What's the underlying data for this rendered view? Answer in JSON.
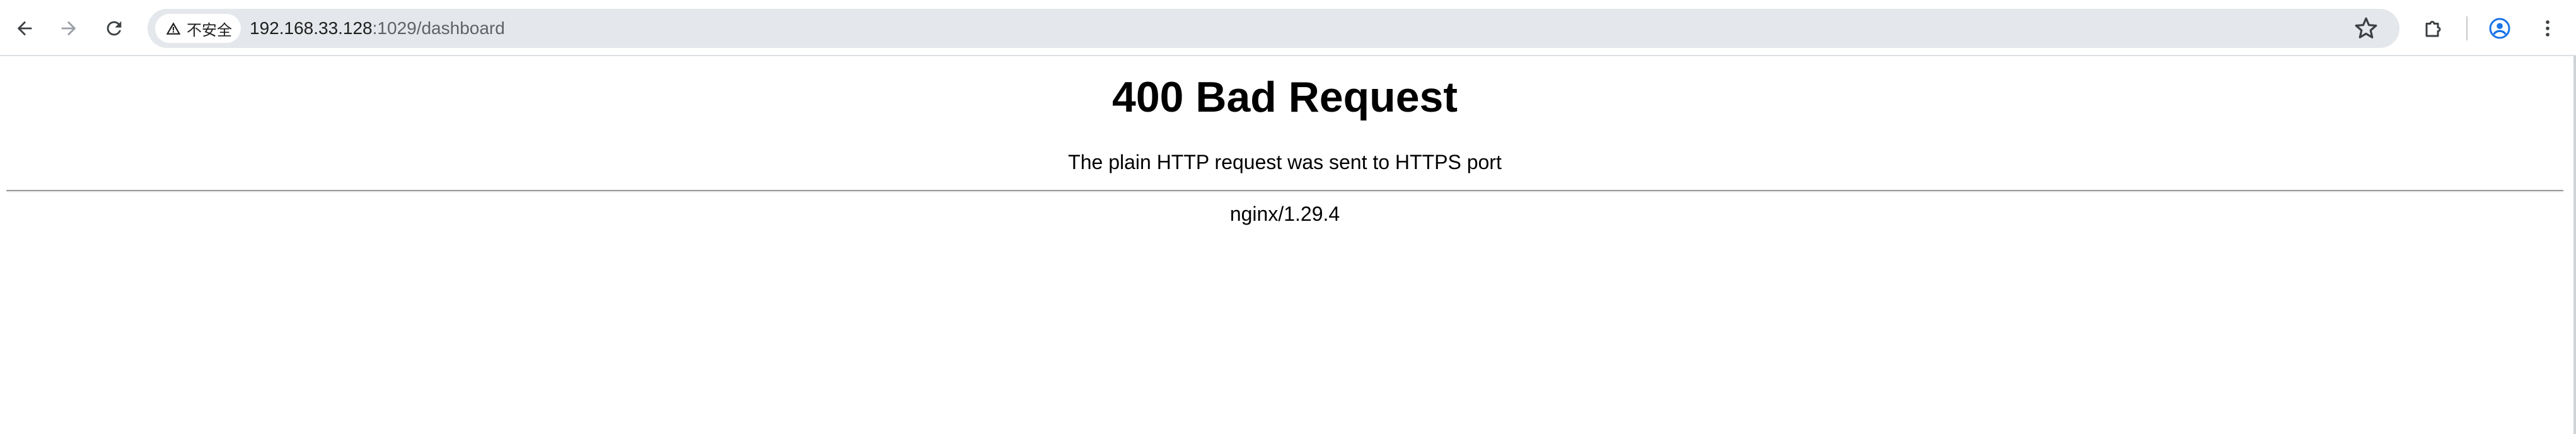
{
  "browser": {
    "security_label": "不安全",
    "url_host": "192.168.33.128",
    "url_path": ":1029/dashboard",
    "icons": {
      "back": "arrow-left-icon",
      "forward": "arrow-right-icon",
      "reload": "reload-icon",
      "security": "warning-triangle-icon",
      "bookmark": "star-icon",
      "extensions": "puzzle-icon",
      "profile": "profile-icon",
      "menu": "kebab-menu-icon"
    },
    "colors": {
      "omnibox_bg": "#e4e7eb",
      "profile_accent": "#1a73e8"
    }
  },
  "page": {
    "title": "400 Bad Request",
    "message": "The plain HTTP request was sent to HTTPS port",
    "server": "nginx/1.29.4"
  }
}
